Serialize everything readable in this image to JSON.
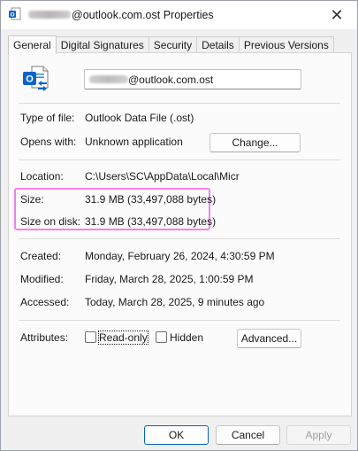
{
  "window": {
    "title_suffix": "@outlook.com.ost Properties",
    "close_glyph": "✕"
  },
  "tabs": [
    {
      "label": "General",
      "active": true
    },
    {
      "label": "Digital Signatures",
      "active": false
    },
    {
      "label": "Security",
      "active": false
    },
    {
      "label": "Details",
      "active": false
    },
    {
      "label": "Previous Versions",
      "active": false
    }
  ],
  "file": {
    "name_suffix": "@outlook.com.ost",
    "icon": "outlook-data-file-icon"
  },
  "details": {
    "type_label": "Type of file:",
    "type_value": "Outlook Data File (.ost)",
    "opens_label": "Opens with:",
    "opens_value": "Unknown application",
    "change_button": "Change...",
    "location_label": "Location:",
    "location_value": "C:\\Users\\SC\\AppData\\Local\\Micr",
    "size_label": "Size:",
    "size_value": "31.9 MB (33,497,088 bytes)",
    "size_disk_label": "Size on disk:",
    "size_disk_value": "31.9 MB (33,497,088 bytes)",
    "created_label": "Created:",
    "created_value": "Monday, February 26, 2024, 4:30:59 PM",
    "modified_label": "Modified:",
    "modified_value": "Friday, March 28, 2025, 1:00:59 PM",
    "accessed_label": "Accessed:",
    "accessed_value": "Today, March 28, 2025, 9 minutes ago",
    "attributes_label": "Attributes:",
    "readonly_label": "Read-only",
    "readonly_checked": false,
    "hidden_label": "Hidden",
    "hidden_checked": false,
    "advanced_button": "Advanced..."
  },
  "footer": {
    "ok": "OK",
    "cancel": "Cancel",
    "apply": "Apply"
  },
  "colors": {
    "highlight": "#ee82ee",
    "outlook_blue": "#0a64c8",
    "primary_border": "#0067c0"
  }
}
